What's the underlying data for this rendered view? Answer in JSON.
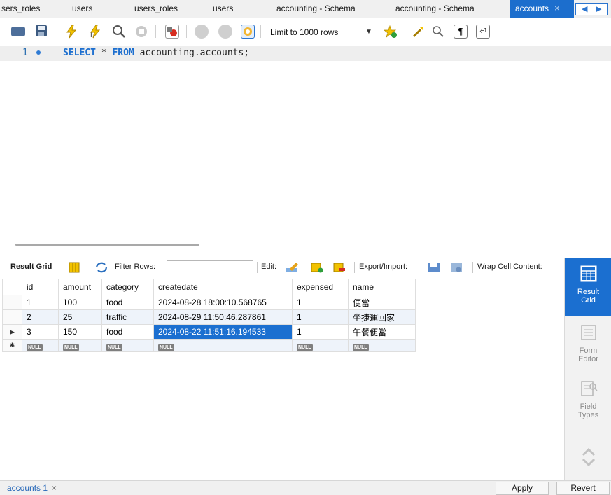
{
  "tabs": [
    {
      "label": "sers_roles"
    },
    {
      "label": "users"
    },
    {
      "label": "users_roles"
    },
    {
      "label": "users"
    },
    {
      "label": "accounting - Schema"
    },
    {
      "label": "accounting - Schema"
    },
    {
      "label": "accounts",
      "active": true
    }
  ],
  "tab_close_glyph": "×",
  "toolbar": {
    "limit_label": "Limit to 1000 rows",
    "icons": [
      "open-file-icon",
      "save-icon",
      "execute-icon",
      "execute-current-icon",
      "explain-icon",
      "stop-icon",
      "toggle-error-icon",
      "commit-icon",
      "rollback-icon",
      "autocommit-icon",
      "add-snippet-icon",
      "beautify-icon",
      "find-icon",
      "invisible-chars-icon",
      "wrap-icon"
    ]
  },
  "editor": {
    "line_number": "1",
    "kw_select": "SELECT",
    "star": " * ",
    "kw_from": "FROM",
    "rest": " accounting.accounts;"
  },
  "result_toolbar": {
    "result_grid": "Result Grid",
    "filter_rows": "Filter Rows:",
    "filter_value": "",
    "edit": "Edit:",
    "export_import": "Export/Import:",
    "wrap": "Wrap Cell Content:"
  },
  "grid": {
    "columns": [
      "id",
      "amount",
      "category",
      "createdate",
      "expensed",
      "name"
    ],
    "rows": [
      [
        "1",
        "100",
        "food",
        "2024-08-28 18:00:10.568765",
        "1",
        "便當"
      ],
      [
        "2",
        "25",
        "traffic",
        "2024-08-29 11:50:46.287861",
        "1",
        "坐捷運回家"
      ],
      [
        "3",
        "150",
        "food",
        "2024-08-22 11:51:16.194533",
        "1",
        "午餐便當"
      ]
    ],
    "null_label": "NULL",
    "current_row_marker": "▶",
    "new_row_marker": "✱"
  },
  "side_panel": {
    "result_grid": [
      "Result",
      "Grid"
    ],
    "form_editor": [
      "Form",
      "Editor"
    ],
    "field_types": [
      "Field",
      "Types"
    ]
  },
  "bottom": {
    "result_tab": "accounts 1",
    "close": "×",
    "apply": "Apply",
    "revert": "Revert"
  },
  "colors": {
    "accent": "#1b6fd0",
    "keyword": "#1d6fcf",
    "editor_line_bg": "#eeeeee"
  }
}
